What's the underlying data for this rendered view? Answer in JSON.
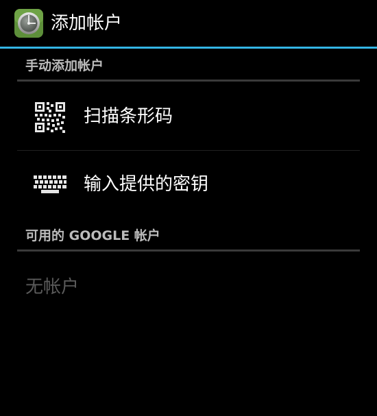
{
  "action_bar": {
    "title": "添加帐户",
    "app_icon": "authenticator-icon"
  },
  "manual_section": {
    "header": "手动添加帐户",
    "items": [
      {
        "label": "扫描条形码",
        "icon": "qr-code-icon"
      },
      {
        "label": "输入提供的密钥",
        "icon": "keyboard-icon"
      }
    ]
  },
  "google_section": {
    "header": "可用的 GOOGLE 帐户",
    "empty_text": "无帐户"
  },
  "colors": {
    "accent": "#33b5e5",
    "background": "#000000",
    "header_text": "#bcbcbc",
    "disabled_text": "#5a5a5a"
  }
}
